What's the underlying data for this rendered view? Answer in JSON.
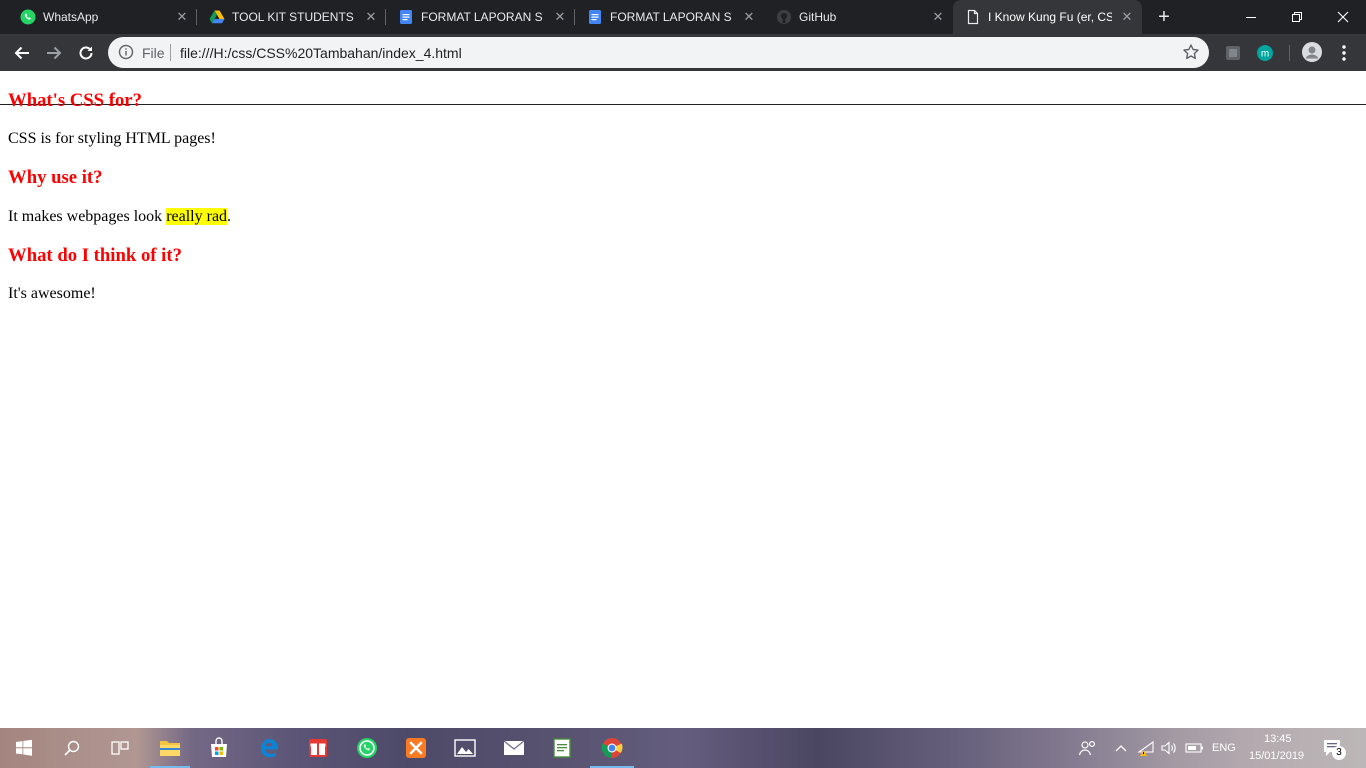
{
  "browser": {
    "tabs": [
      {
        "title": "WhatsApp",
        "icon": "whatsapp-icon"
      },
      {
        "title": "TOOL KIT STUDENTS GO",
        "icon": "google-drive-icon"
      },
      {
        "title": "FORMAT LAPORAN STUDI",
        "icon": "google-docs-icon"
      },
      {
        "title": "FORMAT LAPORAN STUDI",
        "icon": "google-docs-icon"
      },
      {
        "title": "GitHub",
        "icon": "github-icon"
      },
      {
        "title": "I Know Kung Fu (er, CSS)",
        "icon": "page-icon",
        "active": true
      }
    ],
    "omnibox": {
      "scheme_label": "File",
      "url": "file:///H:/css/CSS%20Tambahan/index_4.html"
    }
  },
  "page": {
    "heading_1": "What's CSS for?",
    "para_1": "CSS is for styling HTML pages!",
    "heading_2": "Why use it?",
    "para_2_before": "It makes webpages look ",
    "para_2_highlight": "really rad",
    "para_2_after": ".",
    "heading_3": "What do I think of it?",
    "para_3": "It's awesome!"
  },
  "taskbar": {
    "language": "ENG",
    "time": "13:45",
    "date": "15/01/2019",
    "notification_count": "3"
  },
  "colors": {
    "heading": "#ff0000",
    "highlight": "#ffff00",
    "tabstrip": "#202124",
    "toolbar": "#35363a"
  }
}
